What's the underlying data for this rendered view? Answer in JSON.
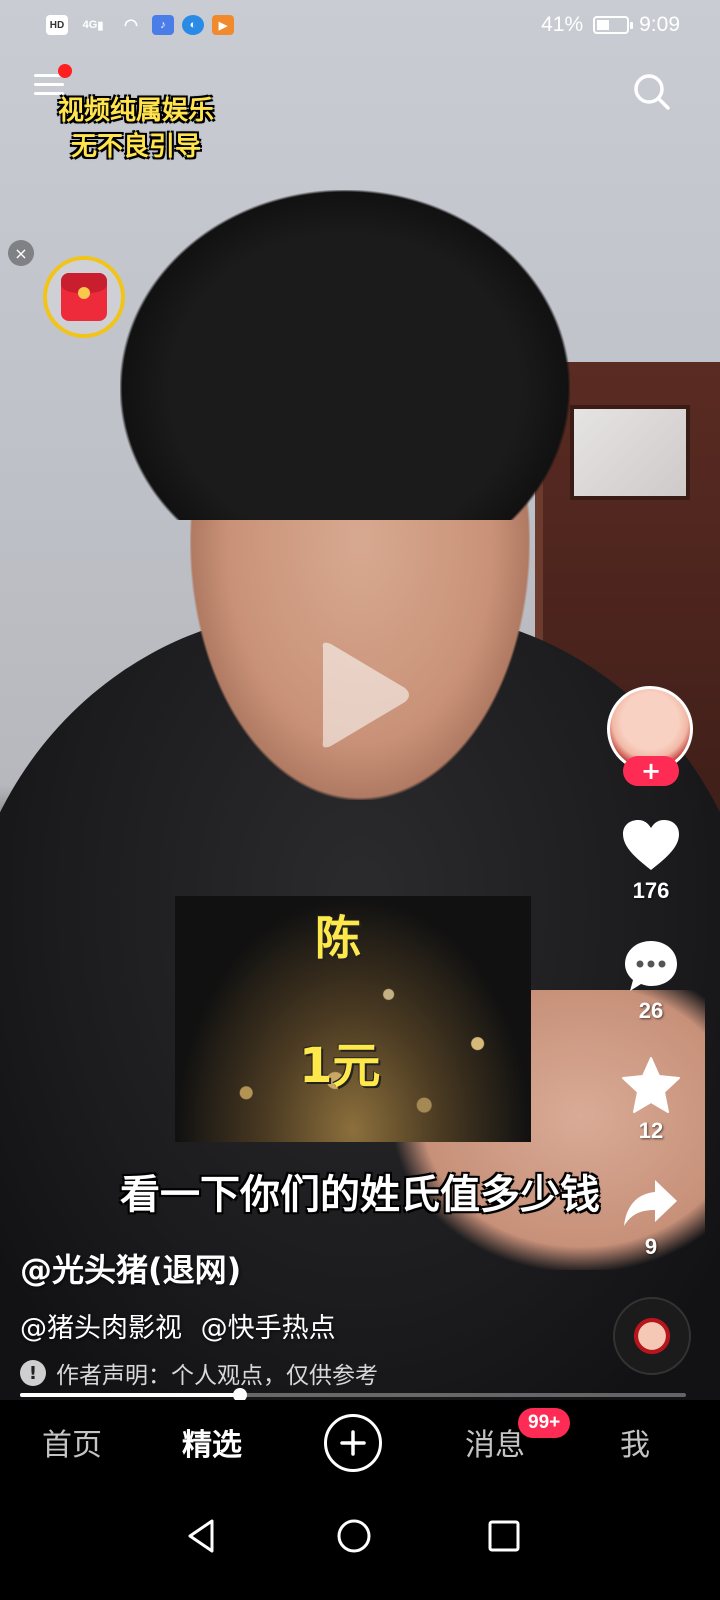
{
  "status_bar": {
    "hd": "HD",
    "network": "4G",
    "battery_percent": "41%",
    "battery_level": 0.41,
    "time": "9:09"
  },
  "overlay": {
    "disclaimer_line1": "视频纯属娱乐",
    "disclaimer_line2": "无不良引导",
    "close_symbol": "×"
  },
  "video": {
    "coin_image": {
      "surname": "陈",
      "value": "1元"
    },
    "subtitle": "看一下你们的姓氏值多少钱"
  },
  "actions": {
    "follow_symbol": "+",
    "likes": "176",
    "comments": "26",
    "favorites": "12",
    "shares": "9"
  },
  "info": {
    "author": "@光头猪(退网)",
    "mentions": [
      "@猪头肉影视",
      "@快手热点"
    ],
    "statement": "作者声明：个人观点，仅供参考",
    "warn_symbol": "!",
    "progress": 0.33
  },
  "bottom_nav": {
    "home": "首页",
    "featured": "精选",
    "messages": "消息",
    "me": "我",
    "messages_badge": "99+"
  },
  "icons": {
    "menu": "menu-icon",
    "search": "search-icon",
    "red_packet": "red-packet-icon",
    "play": "play-icon",
    "like": "heart-icon",
    "comment": "comment-icon",
    "favorite": "star-icon",
    "share": "share-icon",
    "add": "plus-icon",
    "back": "back-triangle-icon",
    "home": "home-circle-icon",
    "recents": "recents-square-icon"
  },
  "colors": {
    "accent": "#fe2c55",
    "caption_yellow": "#ffe44d",
    "packet_ring": "#f2c41a"
  }
}
